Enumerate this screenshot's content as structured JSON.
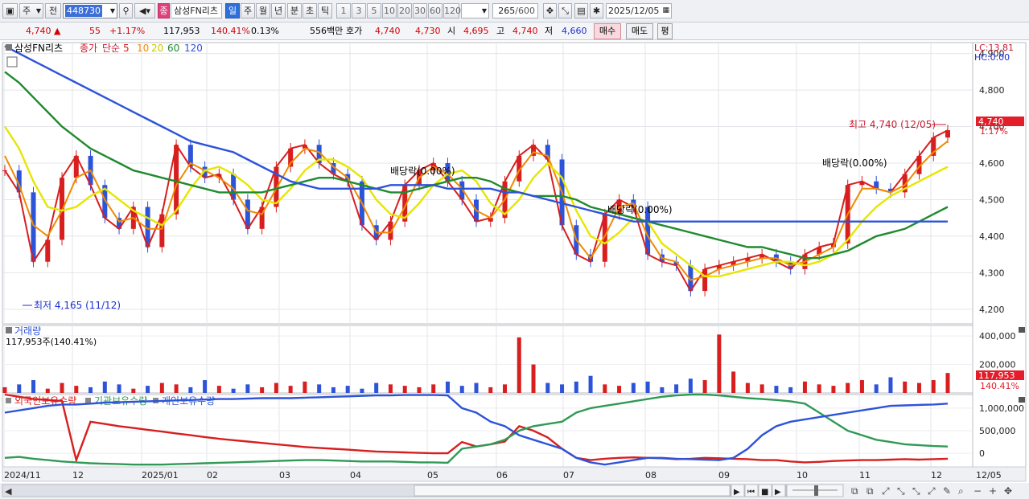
{
  "toolbar": {
    "period_type": "주",
    "market": "전",
    "code": "448730",
    "name_badge": "종",
    "name": "삼성FN리츠",
    "tabs": [
      "일",
      "주",
      "월",
      "년",
      "분",
      "초",
      "틱"
    ],
    "active_tab": "일",
    "intervals": [
      "1",
      "3",
      "5",
      "10",
      "20",
      "30",
      "60",
      "120"
    ],
    "count": "265",
    "count_total": "/600",
    "date": "2025/12/05"
  },
  "quote": {
    "price": "4,740",
    "arrow": "▲",
    "change": "55",
    "change_pct": "+1.17%",
    "volume": "117,953",
    "volume_pct": "140.41%",
    "turnover": "0.13%",
    "amount": "556백만",
    "hoga_label": "호가",
    "bid": "4,740",
    "ask": "4,730",
    "open_label": "시",
    "open": "4,695",
    "high_label": "고",
    "high": "4,740",
    "low_label": "저",
    "low": "4,660",
    "buy_btn": "매수",
    "sell_btn": "매도",
    "flat_btn": "평"
  },
  "price_panel": {
    "legend_name": "삼성FN리츠",
    "legend_close": "종가",
    "legend_simple": "단순",
    "ma_periods": [
      "5",
      "10",
      "20",
      "60",
      "120"
    ],
    "ma_colors": [
      "#d81e1e",
      "#f08a00",
      "#e6e600",
      "#1f8a2e",
      "#2d53d8"
    ],
    "lc_label": "LC:13.81",
    "hc_label": "HC:0.00",
    "y_ticks": [
      "4,900",
      "4,800",
      "4,700",
      "4,600",
      "4,500",
      "4,400",
      "4,300",
      "4,200"
    ],
    "y_values": [
      4900,
      4800,
      4700,
      4600,
      4500,
      4400,
      4300,
      4200
    ],
    "ylim": [
      4160,
      4930
    ],
    "current_price": "4,740",
    "current_pct": "1.17%",
    "max_label": "최고 4,740 (12/05)",
    "min_label": "최저 4,165 (11/12)",
    "div_labels": [
      "배당락(0.00%)",
      "배당락(0.00%)",
      "배당락(0.00%)"
    ]
  },
  "volume_panel": {
    "title": "거래량",
    "value_label": "117,953주(140.41%)",
    "y_ticks": [
      "400,000",
      "200,000"
    ],
    "y_values": [
      400000,
      200000
    ],
    "current": "117,953",
    "current_pct": "140.41%"
  },
  "holdings_panel": {
    "legend": [
      "외국인보유수량",
      "기관보유수량",
      "개인보유수량"
    ],
    "y_ticks": [
      "1,000,000",
      "500,000",
      "0"
    ],
    "y_values": [
      1000000,
      500000,
      0
    ]
  },
  "x_axis": {
    "labels": [
      "2024/11",
      "12",
      "2025/01",
      "02",
      "03",
      "04",
      "05",
      "06",
      "07",
      "08",
      "09",
      "10",
      "11",
      "12",
      "12/05"
    ]
  },
  "chart_data": [
    {
      "type": "candlestick",
      "title": "삼성FN리츠 종가 단순",
      "ylim": [
        4160,
        4930
      ],
      "series": [
        {
          "name": "5",
          "values": [
            4580,
            4520,
            4330,
            4390,
            4560,
            4620,
            4540,
            4450,
            4420,
            4480,
            4370,
            4460,
            4650,
            4590,
            4560,
            4570,
            4500,
            4420,
            4480,
            4590,
            4640,
            4650,
            4600,
            4570,
            4550,
            4430,
            4390,
            4440,
            4540,
            4580,
            4600,
            4550,
            4500,
            4440,
            4450,
            4550,
            4620,
            4650,
            4610,
            4430,
            4350,
            4330,
            4460,
            4500,
            4480,
            4350,
            4330,
            4320,
            4250,
            4310,
            4320,
            4330,
            4340,
            4350,
            4330,
            4310,
            4350,
            4370,
            4380,
            4540,
            4550,
            4530,
            4520,
            4570,
            4620,
            4670,
            4690
          ]
        },
        {
          "name": "10",
          "values": [
            4620,
            4540,
            4430,
            4400,
            4470,
            4560,
            4580,
            4500,
            4440,
            4450,
            4420,
            4420,
            4540,
            4600,
            4580,
            4560,
            4530,
            4470,
            4460,
            4530,
            4600,
            4640,
            4630,
            4590,
            4560,
            4490,
            4410,
            4410,
            4480,
            4560,
            4590,
            4570,
            4530,
            4470,
            4450,
            4500,
            4580,
            4630,
            4620,
            4520,
            4390,
            4340,
            4400,
            4480,
            4490,
            4400,
            4340,
            4330,
            4280,
            4290,
            4310,
            4320,
            4330,
            4340,
            4340,
            4320,
            4330,
            4350,
            4370,
            4460,
            4530,
            4530,
            4520,
            4540,
            4590,
            4630,
            4660
          ]
        },
        {
          "name": "20",
          "values": [
            4700,
            4640,
            4550,
            4480,
            4470,
            4480,
            4510,
            4530,
            4500,
            4470,
            4450,
            4430,
            4470,
            4530,
            4580,
            4590,
            4570,
            4540,
            4500,
            4490,
            4530,
            4580,
            4610,
            4610,
            4590,
            4560,
            4500,
            4460,
            4450,
            4490,
            4540,
            4570,
            4580,
            4550,
            4490,
            4460,
            4500,
            4560,
            4600,
            4560,
            4470,
            4400,
            4380,
            4410,
            4450,
            4440,
            4380,
            4350,
            4320,
            4290,
            4290,
            4300,
            4310,
            4320,
            4330,
            4330,
            4320,
            4330,
            4350,
            4390,
            4440,
            4480,
            4510,
            4530,
            4550,
            4570,
            4590
          ]
        },
        {
          "name": "60",
          "values": [
            4850,
            4820,
            4780,
            4740,
            4700,
            4670,
            4640,
            4620,
            4600,
            4580,
            4570,
            4560,
            4550,
            4540,
            4530,
            4520,
            4520,
            4520,
            4520,
            4530,
            4540,
            4550,
            4560,
            4560,
            4550,
            4540,
            4530,
            4520,
            4520,
            4530,
            4540,
            4550,
            4560,
            4560,
            4550,
            4530,
            4520,
            4510,
            4510,
            4510,
            4500,
            4480,
            4470,
            4460,
            4450,
            4440,
            4430,
            4420,
            4410,
            4400,
            4390,
            4380,
            4370,
            4370,
            4360,
            4350,
            4340,
            4340,
            4350,
            4360,
            4380,
            4400,
            4410,
            4420,
            4440,
            4460,
            4480
          ]
        },
        {
          "name": "120",
          "values": [
            4920,
            4900,
            4880,
            4860,
            4840,
            4820,
            4800,
            4780,
            4760,
            4740,
            4720,
            4700,
            4680,
            4660,
            4650,
            4640,
            4630,
            4610,
            4590,
            4570,
            4550,
            4540,
            4530,
            4530,
            4530,
            4530,
            4530,
            4540,
            4540,
            4540,
            4540,
            4530,
            4530,
            4530,
            4530,
            4520,
            4520,
            4510,
            4500,
            4490,
            4480,
            4470,
            4460,
            4450,
            4440,
            4440,
            4440,
            4440,
            4440,
            4440,
            4440,
            4440,
            4440,
            4440,
            4440,
            4440,
            4440,
            4440,
            4440,
            4440,
            4440,
            4440,
            4440,
            4440,
            4440,
            4440,
            4440
          ]
        }
      ]
    },
    {
      "type": "bar",
      "title": "거래량",
      "ylim": [
        0,
        440000
      ],
      "values": [
        40,
        60,
        90,
        30,
        70,
        50,
        40,
        80,
        60,
        30,
        50,
        70,
        60,
        40,
        90,
        50,
        30,
        60,
        40,
        70,
        50,
        80,
        60,
        40,
        50,
        30,
        70,
        60,
        50,
        40,
        60,
        80,
        50,
        70,
        40,
        60,
        390,
        200,
        70,
        60,
        80,
        120,
        60,
        50,
        70,
        80,
        40,
        60,
        100,
        90,
        410,
        150,
        70,
        60,
        50,
        40,
        80,
        60,
        50,
        70,
        90,
        60,
        110,
        80,
        70,
        90,
        140
      ]
    },
    {
      "type": "line",
      "title": "보유수량",
      "ylim": [
        -300000,
        1300000
      ],
      "series": [
        {
          "name": "외국인보유수량",
          "values": [
            1300000,
            1250000,
            1200000,
            1180000,
            1160000,
            -150000,
            700000,
            650000,
            600000,
            560000,
            520000,
            480000,
            440000,
            400000,
            360000,
            320000,
            290000,
            260000,
            230000,
            200000,
            170000,
            140000,
            120000,
            100000,
            80000,
            60000,
            40000,
            30000,
            20000,
            10000,
            0,
            0,
            250000,
            150000,
            200000,
            260000,
            600000,
            500000,
            350000,
            100000,
            -100000,
            -150000,
            -120000,
            -100000,
            -90000,
            -100000,
            -110000,
            -130000,
            -120000,
            -100000,
            -110000,
            -120000,
            -130000,
            -150000,
            -150000,
            -180000,
            -200000,
            -190000,
            -170000,
            -160000,
            -150000,
            -150000,
            -140000,
            -130000,
            -140000,
            -130000,
            -120000
          ]
        },
        {
          "name": "기관보유수량",
          "values": [
            -100000,
            -80000,
            -120000,
            -150000,
            -180000,
            -200000,
            -220000,
            -230000,
            -240000,
            -250000,
            -250000,
            -250000,
            -240000,
            -230000,
            -220000,
            -210000,
            -200000,
            -190000,
            -180000,
            -170000,
            -160000,
            -150000,
            -150000,
            -160000,
            -170000,
            -180000,
            -180000,
            -180000,
            -190000,
            -200000,
            -200000,
            -210000,
            100000,
            150000,
            200000,
            300000,
            500000,
            600000,
            650000,
            700000,
            900000,
            1000000,
            1050000,
            1100000,
            1150000,
            1200000,
            1250000,
            1280000,
            1300000,
            1300000,
            1280000,
            1250000,
            1220000,
            1200000,
            1180000,
            1150000,
            1100000,
            900000,
            700000,
            500000,
            400000,
            300000,
            250000,
            200000,
            180000,
            160000,
            150000
          ]
        },
        {
          "name": "개인보유수량",
          "values": [
            900000,
            950000,
            1000000,
            1050000,
            1080000,
            1080000,
            1100000,
            1120000,
            1130000,
            1140000,
            1150000,
            1160000,
            1170000,
            1180000,
            1190000,
            1200000,
            1200000,
            1210000,
            1220000,
            1220000,
            1220000,
            1230000,
            1240000,
            1250000,
            1260000,
            1270000,
            1280000,
            1280000,
            1290000,
            1290000,
            1290000,
            1280000,
            1000000,
            900000,
            700000,
            600000,
            400000,
            300000,
            200000,
            100000,
            -100000,
            -200000,
            -250000,
            -200000,
            -150000,
            -100000,
            -100000,
            -120000,
            -130000,
            -140000,
            -150000,
            -100000,
            100000,
            400000,
            600000,
            700000,
            750000,
            800000,
            850000,
            900000,
            950000,
            1000000,
            1050000,
            1060000,
            1070000,
            1080000,
            1100000
          ]
        }
      ]
    }
  ]
}
